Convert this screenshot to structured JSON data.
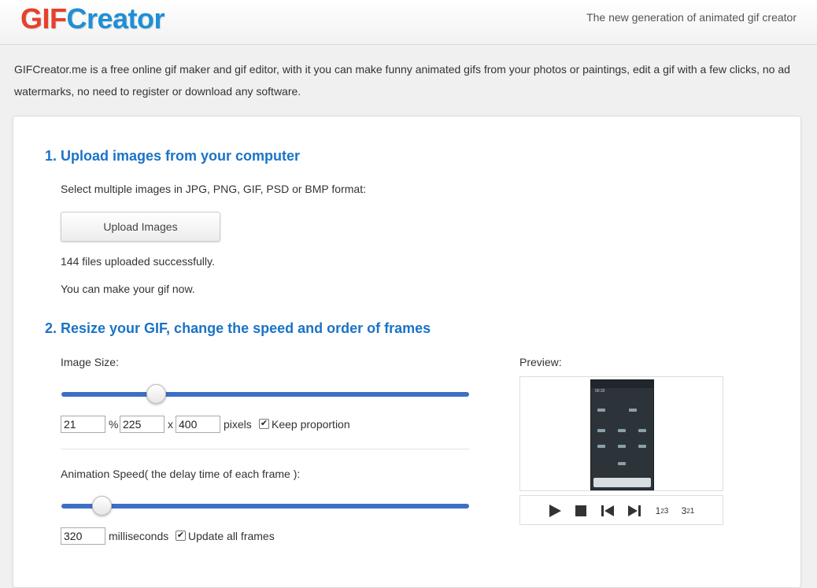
{
  "header": {
    "logo_part1": "GIF",
    "logo_part2": "Creator",
    "tagline": "The new generation of animated gif creator"
  },
  "intro": "GIFCreator.me is a free online gif maker and gif editor, with it you can make funny animated gifs from your photos or paintings, edit a gif with a few clicks, no ad watermarks, no need to register or download any software.",
  "step1": {
    "title": "1. Upload images from your computer",
    "instruction": "Select multiple images in JPG, PNG, GIF, PSD or BMP format:",
    "upload_button": "Upload Images",
    "status": "144 files uploaded successfully.",
    "hint": "You can make your gif now."
  },
  "step2": {
    "title": "2. Resize your GIF, change the speed and order of frames",
    "image_size_label": "Image Size:",
    "size_slider_level": 0.22,
    "percent_value": "21",
    "percent_sign": "%",
    "width_value": "225",
    "times_sign": "x",
    "height_value": "400",
    "pixels_label": "pixels",
    "keep_proportion_label": "Keep proportion",
    "keep_proportion_checked": true,
    "speed_label": "Animation Speed( the delay time of each frame ):",
    "speed_slider_level": 0.08,
    "speed_value": "320",
    "ms_label": "milliseconds",
    "update_all_label": "Update all frames",
    "update_all_checked": true
  },
  "preview": {
    "label": "Preview:",
    "phone_time": "00:32",
    "controls": [
      "play-icon",
      "stop-icon",
      "skip-back-icon",
      "skip-forward-icon",
      "order-ascending-icon",
      "order-descending-icon"
    ]
  },
  "colors": {
    "logo_gif": "#e8402c",
    "logo_creator": "#1f8fd6",
    "heading": "#1a73c7",
    "slider_track": "#3d6fc7"
  }
}
